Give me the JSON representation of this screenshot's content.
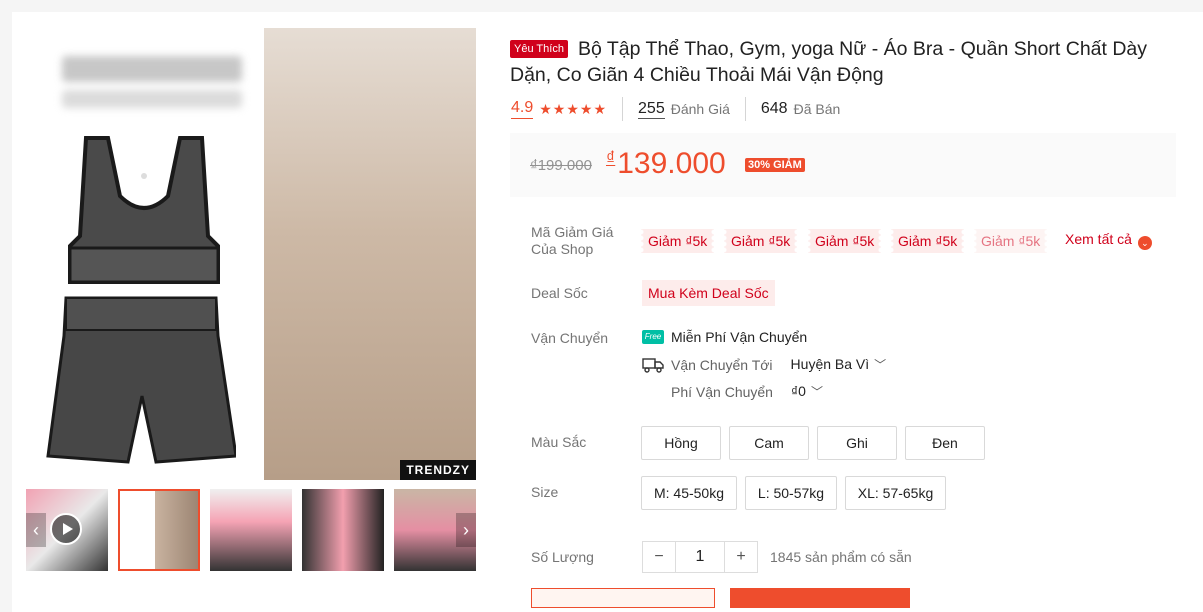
{
  "gallery": {
    "watermark": "TRENDZY",
    "thumbnails": [
      "video",
      "image-2",
      "image-3",
      "image-4",
      "image-5"
    ]
  },
  "product": {
    "badge": "Yêu Thích",
    "title": "Bộ Tập Thể Thao, Gym, yoga Nữ - Áo Bra - Quần Short Chất Dày Dặn, Co Giãn 4 Chiều Thoải Mái Vận Động",
    "rating": "4.9",
    "stars": "★★★★★",
    "reviews_count": "255",
    "reviews_label": "Đánh Giá",
    "sold_count": "648",
    "sold_label": "Đã Bán"
  },
  "price": {
    "old": "₫199.000",
    "currency": "₫",
    "new": "139.000",
    "discount": "30% GIẢM",
    "accent_color": "#ee4d2d"
  },
  "vouchers": {
    "label": "Mã Giảm Giá Của Shop",
    "items": [
      "Giảm ₫5k",
      "Giảm ₫5k",
      "Giảm ₫5k",
      "Giảm ₫5k",
      "Giảm ₫5k"
    ],
    "see_all": "Xem tất cả"
  },
  "deal": {
    "label": "Deal Sốc",
    "value": "Mua Kèm Deal Sốc"
  },
  "shipping": {
    "label": "Vận Chuyển",
    "free_icon": "Free",
    "free": "Miễn Phí Vận Chuyển",
    "to_label": "Vận Chuyển Tới",
    "to_value": "Huyện Ba Vì",
    "fee_label": "Phí Vận Chuyển",
    "fee_value": "₫0"
  },
  "color": {
    "label": "Màu Sắc",
    "options": [
      "Hồng",
      "Cam",
      "Ghi",
      "Đen"
    ]
  },
  "size": {
    "label": "Size",
    "options": [
      "M: 45-50kg",
      "L: 50-57kg",
      "XL: 57-65kg"
    ]
  },
  "quantity": {
    "label": "Số Lượng",
    "minus": "−",
    "value": "1",
    "plus": "+",
    "available": "1845 sản phẩm có sẵn"
  }
}
